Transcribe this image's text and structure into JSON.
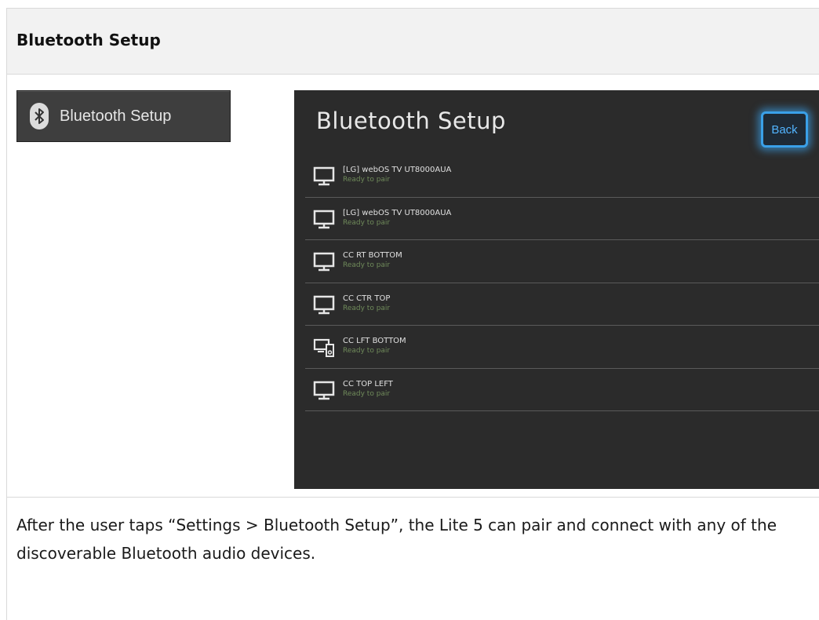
{
  "header": {
    "title": "Bluetooth Setup"
  },
  "menu_button": {
    "label": "Bluetooth Setup",
    "icon": "bluetooth-icon"
  },
  "screen": {
    "title": "Bluetooth Setup",
    "back_label": "Back",
    "accent_color": "#3aa0e8",
    "devices": [
      {
        "name": "[LG] webOS TV UT8000AUA",
        "status": "Ready to pair",
        "icon": "monitor-icon"
      },
      {
        "name": "[LG] webOS TV UT8000AUA",
        "status": "Ready to pair",
        "icon": "monitor-icon"
      },
      {
        "name": "CC RT BOTTOM",
        "status": "Ready to pair",
        "icon": "monitor-icon"
      },
      {
        "name": "CC CTR TOP",
        "status": "Ready to pair",
        "icon": "monitor-icon"
      },
      {
        "name": "CC LFT BOTTOM",
        "status": "Ready to pair",
        "icon": "computer-speaker-icon"
      },
      {
        "name": "CC TOP LEFT",
        "status": "Ready to pair",
        "icon": "monitor-icon"
      }
    ]
  },
  "caption": "After the user taps “Settings > Bluetooth Setup”, the Lite 5 can pair and connect with any of the discoverable Bluetooth audio devices."
}
